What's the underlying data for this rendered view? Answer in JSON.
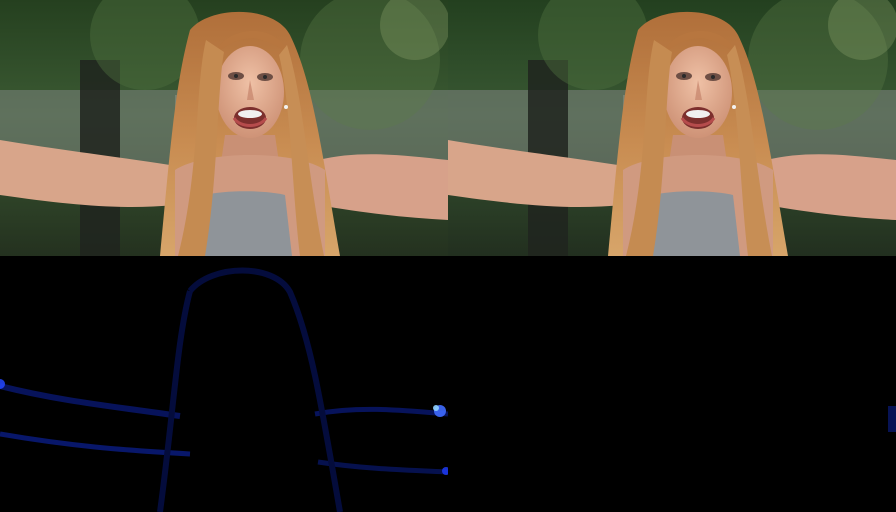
{
  "panels": [
    {
      "id": "photo-left",
      "kind": "photo"
    },
    {
      "id": "photo-right",
      "kind": "photo"
    },
    {
      "id": "mask-left",
      "kind": "dark-blue-outline"
    },
    {
      "id": "mask-right",
      "kind": "dark"
    }
  ],
  "colors": {
    "foliage_dark": "#1f3a22",
    "foliage_mid": "#3c5d35",
    "foliage_light": "#6f8b5a",
    "background_street": "#8c8f8a",
    "skin": "#d9a58a",
    "skin_shadow": "#b97d64",
    "hair_light": "#d7a56a",
    "hair_mid": "#b06f3a",
    "hair_dark": "#7a4526",
    "top": "#8f9499",
    "mask_bg": "#000000",
    "mask_edge": "#0a1a7a",
    "mask_edge_bright": "#3f6bff"
  }
}
